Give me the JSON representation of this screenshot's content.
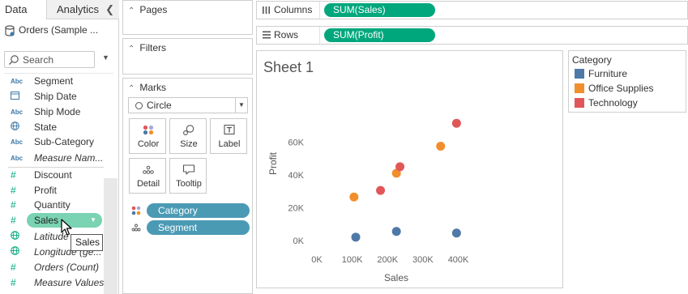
{
  "data_pane": {
    "tab_data": "Data",
    "tab_analytics": "Analytics",
    "datasource": "Orders (Sample ...",
    "search_placeholder": "Search",
    "dimensions": [
      {
        "type": "Abc",
        "name": "Segment",
        "italic": false
      },
      {
        "type": "date",
        "name": "Ship Date",
        "italic": false
      },
      {
        "type": "Abc",
        "name": "Ship Mode",
        "italic": false
      },
      {
        "type": "globe",
        "name": "State",
        "italic": false
      },
      {
        "type": "Abc",
        "name": "Sub-Category",
        "italic": false
      },
      {
        "type": "Abc",
        "name": "Measure Nam...",
        "italic": true
      }
    ],
    "measures": [
      {
        "type": "#",
        "name": "Discount",
        "italic": false
      },
      {
        "type": "#",
        "name": "Profit",
        "italic": false
      },
      {
        "type": "#",
        "name": "Quantity",
        "italic": false
      },
      {
        "type": "#",
        "name": "Sales",
        "italic": false,
        "dragging": true
      },
      {
        "type": "globe",
        "name": "Latitude",
        "italic": true
      },
      {
        "type": "globe",
        "name": "Longitude (ge...",
        "italic": true
      },
      {
        "type": "#",
        "name": "Orders (Count)",
        "italic": true
      },
      {
        "type": "#",
        "name": "Measure Values",
        "italic": true
      }
    ],
    "drag_pill": "Sales",
    "drag_tooltip": "Sales"
  },
  "cards": {
    "pages_title": "Pages",
    "filters_title": "Filters",
    "marks_title": "Marks",
    "mark_type": "Circle",
    "buttons": {
      "color": "Color",
      "size": "Size",
      "label": "Label",
      "detail": "Detail",
      "tooltip": "Tooltip"
    },
    "encodings": [
      {
        "kind": "color",
        "field": "Category"
      },
      {
        "kind": "detail",
        "field": "Segment"
      }
    ]
  },
  "shelves": {
    "columns_label": "Columns",
    "columns_pill": "SUM(Sales)",
    "rows_label": "Rows",
    "rows_pill": "SUM(Profit)"
  },
  "sheet_title": "Sheet 1",
  "legend": {
    "title": "Category",
    "items": [
      {
        "label": "Furniture",
        "color": "#4e79a7"
      },
      {
        "label": "Office Supplies",
        "color": "#f28e2b"
      },
      {
        "label": "Technology",
        "color": "#e15759"
      }
    ]
  },
  "colors": {
    "measure_green": "#00a77d",
    "dimension_blue": "#4b9ab4",
    "drag_pill": "#7ad3b2"
  },
  "chart_data": {
    "type": "scatter",
    "xlabel": "Sales",
    "ylabel": "Profit",
    "xlim": [
      0,
      440000
    ],
    "ylim": [
      -6000,
      80000
    ],
    "x_ticks": [
      {
        "value": 0,
        "label": "0K"
      },
      {
        "value": 100000,
        "label": "100K"
      },
      {
        "value": 200000,
        "label": "200K"
      },
      {
        "value": 300000,
        "label": "300K"
      },
      {
        "value": 400000,
        "label": "400K"
      }
    ],
    "y_ticks": [
      {
        "value": 0,
        "label": "0K"
      },
      {
        "value": 20000,
        "label": "20K"
      },
      {
        "value": 40000,
        "label": "40K"
      },
      {
        "value": 60000,
        "label": "60K"
      }
    ],
    "grid": false,
    "series": [
      {
        "name": "Furniture",
        "color": "#4e79a7",
        "points": [
          [
            110000,
            2000
          ],
          [
            225000,
            5500
          ],
          [
            395000,
            4500
          ]
        ]
      },
      {
        "name": "Office Supplies",
        "color": "#f28e2b",
        "points": [
          [
            105000,
            26500
          ],
          [
            225000,
            41000
          ],
          [
            350000,
            57500
          ]
        ]
      },
      {
        "name": "Technology",
        "color": "#e15759",
        "points": [
          [
            180000,
            30500
          ],
          [
            235000,
            45000
          ],
          [
            395000,
            71500
          ]
        ]
      }
    ]
  }
}
